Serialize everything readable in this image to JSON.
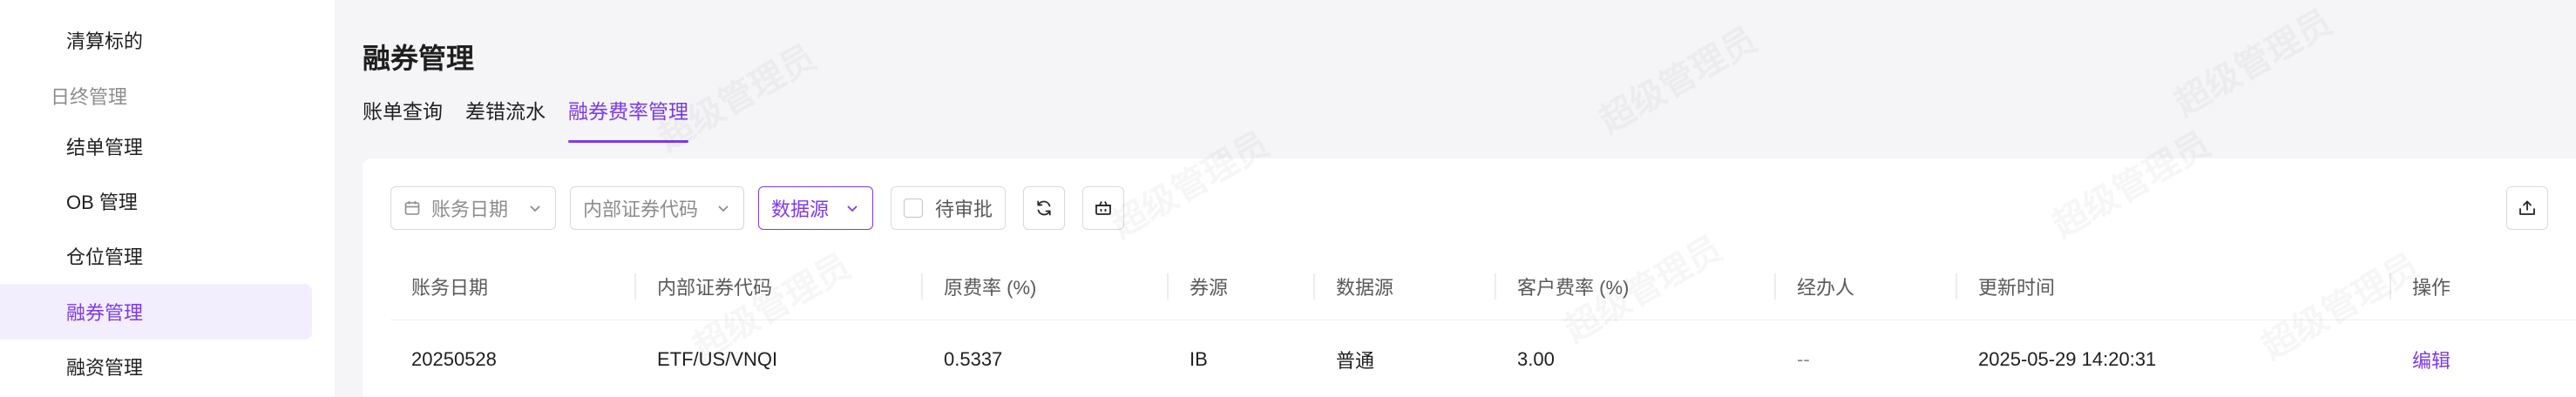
{
  "sidebar": {
    "items": [
      {
        "label": "清算标的"
      },
      {
        "label": "结单管理"
      },
      {
        "label": "OB 管理"
      },
      {
        "label": "仓位管理"
      },
      {
        "label": "融券管理"
      },
      {
        "label": "融资管理"
      }
    ],
    "group_label": "日终管理",
    "active": "融券管理"
  },
  "page": {
    "title": "融券管理",
    "tabs": [
      {
        "label": "账单查询"
      },
      {
        "label": "差错流水"
      },
      {
        "label": "融券费率管理"
      }
    ],
    "active_tab": "融券费率管理"
  },
  "filters": {
    "date_placeholder": "账务日期",
    "code_placeholder": "内部证券代码",
    "source_placeholder": "数据源",
    "pending_label": "待审批"
  },
  "icons": {
    "calendar": "calendar-icon",
    "refresh": "refresh-icon",
    "basket": "basket-icon",
    "export": "export-icon",
    "chevron": "chevron-down-icon"
  },
  "table": {
    "headers": [
      "账务日期",
      "内部证券代码",
      "原费率 (%)",
      "券源",
      "数据源",
      "客户费率 (%)",
      "经办人",
      "更新时间",
      "操作"
    ],
    "rows": [
      [
        "20250528",
        "ETF/US/VNQI",
        "0.5337",
        "IB",
        "普通",
        "3.00",
        "--",
        "2025-05-29 14:20:31",
        "编辑"
      ]
    ]
  },
  "watermark": "超级管理员",
  "colors": {
    "accent": "#7c3aed",
    "active_bg": "#f3eefe",
    "page_bg": "#f5f5f7"
  }
}
